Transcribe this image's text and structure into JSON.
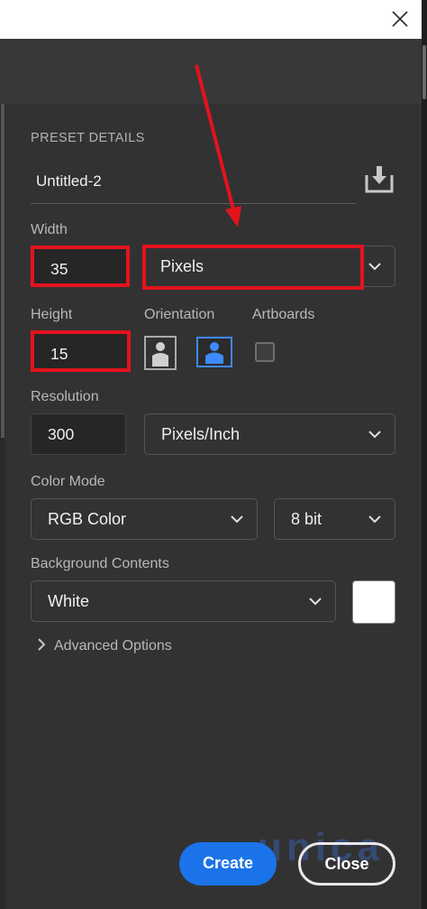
{
  "dialog": {
    "section_title": "PRESET DETAILS",
    "document_name": "Untitled-2",
    "labels": {
      "width": "Width",
      "height": "Height",
      "orientation": "Orientation",
      "artboards": "Artboards",
      "resolution": "Resolution",
      "color_mode": "Color Mode",
      "background_contents": "Background Contents"
    },
    "width_value": "35",
    "width_unit": "Pixels",
    "height_value": "15",
    "orientation_selected": "landscape",
    "artboards_checked": false,
    "resolution_value": "300",
    "resolution_unit": "Pixels/Inch",
    "color_mode": "RGB Color",
    "bit_depth": "8 bit",
    "background_contents": "White",
    "background_swatch_color": "#ffffff",
    "advanced_options": "Advanced Options",
    "buttons": {
      "create": "Create",
      "close": "Close"
    }
  },
  "watermark": "unica",
  "colors": {
    "accent": "#1a73e8",
    "highlight": "#e3131e",
    "panel": "#323232"
  }
}
